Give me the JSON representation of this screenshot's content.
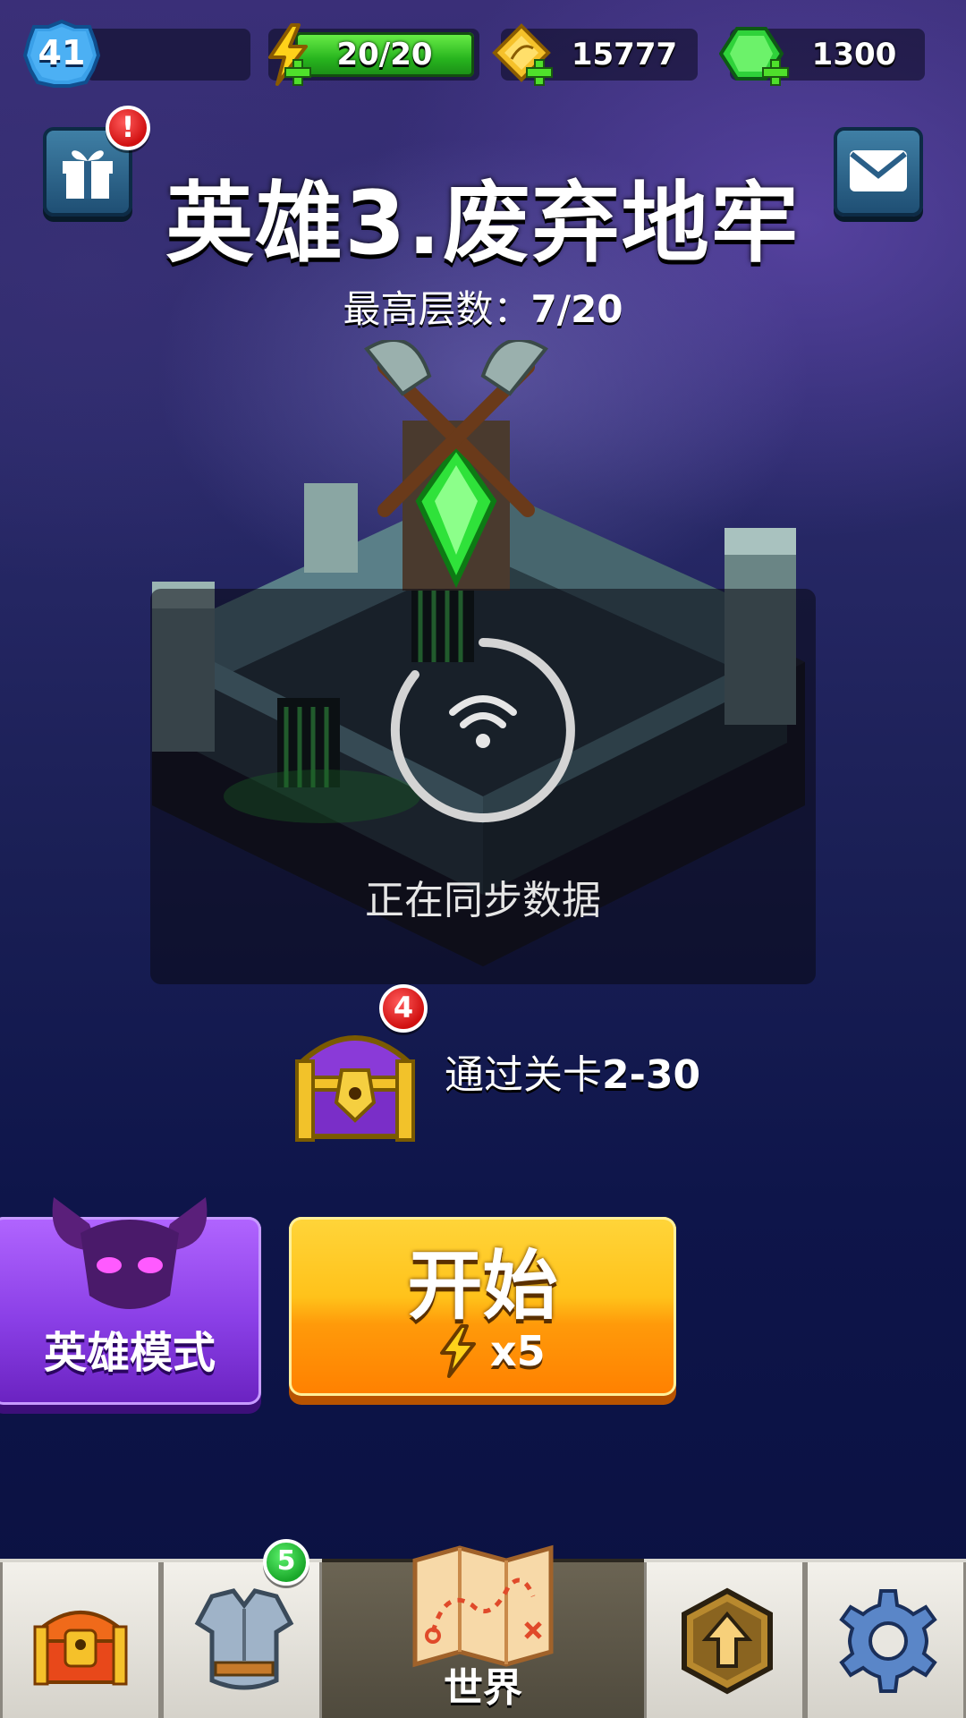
{
  "hud": {
    "level": "41",
    "energy": "20/20",
    "coins": "15777",
    "gems": "1300"
  },
  "header": {
    "title": "英雄3.废弃地牢",
    "best_floor_label": "最高层数：",
    "best_floor_value": "7/20"
  },
  "badges": {
    "gift_alert": "!",
    "chest_count": "4",
    "equipment_count": "5"
  },
  "sync": {
    "text": "正在同步数据"
  },
  "reward": {
    "text_prefix": "通过关卡",
    "stage": "2-30"
  },
  "buttons": {
    "hero_mode": "英雄模式",
    "start": "开始",
    "cost": "x5"
  },
  "nav": {
    "active_label": "世界"
  },
  "colors": {
    "energy_green": "#27b41e",
    "start_yellow": "#ffc21a",
    "hero_purple": "#8a3fe6",
    "alert_red": "#d01010"
  }
}
